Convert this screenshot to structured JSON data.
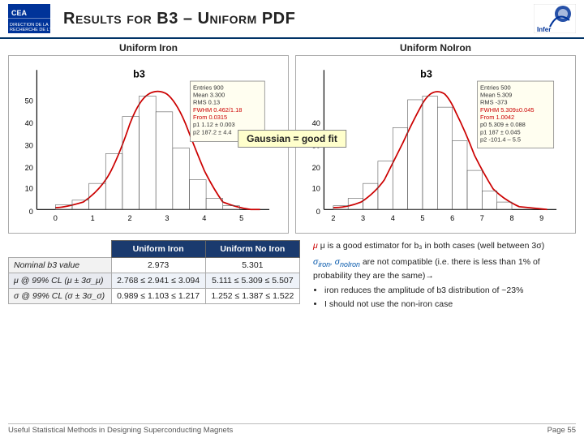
{
  "header": {
    "title": "Results for B3 – Uniform PDF",
    "logo_cea_alt": "CEA logo",
    "logo_infer_alt": "Infer logo"
  },
  "plots": {
    "left_label": "Uniform Iron",
    "right_label": "Uniform NoIron",
    "left_plot_title": "b3",
    "right_plot_title": "b3",
    "gaussian_annotation": "Gaussian = good fit",
    "left_stats": {
      "entries": "900",
      "mean": "3.300",
      "rms": "0.13",
      "fwhm": "0.462 / 1.18",
      "from": "0.0315",
      "p0": "",
      "p1": "1.12 ± 0.003",
      "p2": "187.2 ± 4.4"
    },
    "right_stats": {
      "entries": "500",
      "mean": "5.309",
      "rms": "-373",
      "fwhm": "5.309 ± 0.045",
      "from": "1.0042",
      "p0": "5.309 ± 0.088",
      "p1": "187 ± 0.045",
      "p2": "-101.4 – 5.5"
    }
  },
  "table": {
    "headers": [
      "",
      "Uniform Iron",
      "Uniform No Iron"
    ],
    "rows": [
      {
        "label": "Nominal b3 value",
        "col1": "2.973",
        "col2": "5.301"
      },
      {
        "label": "μ @ 99% CL (μ ± 3σ_μ)",
        "col1": "2.768 ≤ 2.941 ≤ 3.094",
        "col2": "5.111 ≤ 5.309 ≤ 5.507"
      },
      {
        "label": "σ @ 99% CL (σ ± 3σ_σ)",
        "col1": "0.989 ≤ 1.103 ≤ 1.217",
        "col2": "1.252 ≤ 1.387 ≤ 1.522"
      }
    ]
  },
  "text_panel": {
    "line1": "μ is a good estimator for b₃ in both cases (well between 3σ)",
    "line2": "σ_iron, σ_noIron are not compatible (i.e. there is less than 1% of probability they are the same)→",
    "bullets": [
      "iron reduces the amplitude of b3 distribution of ~23%",
      "I should not use the non-iron case"
    ]
  },
  "footer": {
    "left": "Useful Statistical Methods in Designing Superconducting Magnets",
    "right": "Page 55"
  }
}
